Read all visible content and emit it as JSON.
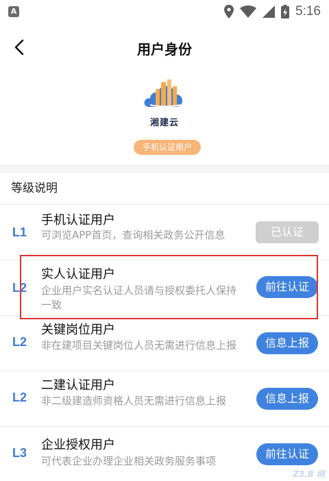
{
  "status_bar": {
    "time": "5:16",
    "app_icon_letter": "A",
    "icons": [
      "location-icon",
      "wifi-icon",
      "signal-icon",
      "battery-icon"
    ]
  },
  "header": {
    "title": "用户身份",
    "logo_text": "湘建云",
    "level_badge": "手机认证用户"
  },
  "section": {
    "title": "等级说明",
    "items": [
      {
        "level": "L1",
        "title": "手机认证用户",
        "desc": "可浏览APP首页，查询相关政务公开信息",
        "action": "已认证",
        "action_state": "done"
      },
      {
        "level": "L2",
        "title": "实人认证用户",
        "desc": "企业用户实名认证人员请与授权委托人保持一致",
        "action": "前往认证",
        "action_state": "active"
      },
      {
        "level": "L2",
        "title": "关键岗位用户",
        "desc": "非在建项目关键岗位人员无需进行信息上报",
        "action": "信息上报",
        "action_state": "active"
      },
      {
        "level": "L2",
        "title": "二建认证用户",
        "desc": "非二级建造师资格人员无需进行信息上报",
        "action": "信息上报",
        "action_state": "active"
      },
      {
        "level": "L3",
        "title": "企业授权用户",
        "desc": "可代表企业办理企业相关政务服务事项",
        "action": "前往认证",
        "action_state": "active"
      }
    ]
  },
  "watermark": "Z3.B 网",
  "colors": {
    "accent_blue": "#3f82e0",
    "badge_orange": "#f7b577",
    "disabled_gray": "#cfcfcf",
    "highlight_red": "#e0302f"
  }
}
